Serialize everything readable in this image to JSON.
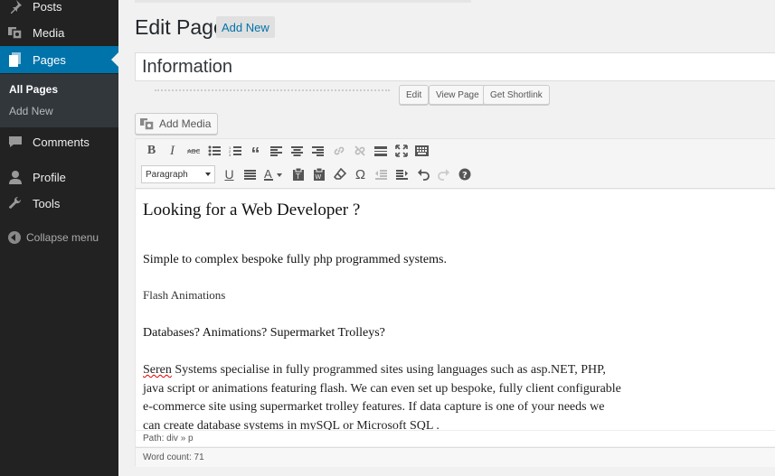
{
  "sidebar": {
    "menu": [
      {
        "label": "Posts",
        "icon": "pin-icon"
      },
      {
        "label": "Media",
        "icon": "media-icon"
      },
      {
        "label": "Pages",
        "icon": "pages-icon"
      },
      {
        "label": "Comments",
        "icon": "comment-icon"
      },
      {
        "label": "Profile",
        "icon": "user-icon"
      },
      {
        "label": "Tools",
        "icon": "wrench-icon"
      }
    ],
    "submenu": [
      {
        "label": "All Pages"
      },
      {
        "label": "Add New"
      }
    ],
    "collapse_label": "Collapse menu"
  },
  "header": {
    "title": "Edit Page",
    "add_new_label": "Add New"
  },
  "post_title": "Information",
  "permalink_buttons": {
    "edit": "Edit",
    "view_page": "View Page",
    "get_shortlink": "Get Shortlink"
  },
  "add_media_label": "Add Media",
  "editor": {
    "format_select": "Paragraph",
    "content": {
      "heading": "Looking for a Web Developer ?",
      "p1": "Simple to complex bespoke fully php programmed systems.",
      "p2": "Flash Animations",
      "p3": "Databases? Animations? Supermarket Trolleys?",
      "p4_first_word": "Seren",
      "p4_rest": " Systems specialise in fully programmed sites using languages such as asp.NET, PHP, java script or animations featuring flash. We can even set up bespoke, fully client configurable e-commerce site using supermarket trolley features. If data capture is one of your needs we can create database systems in mySQL or Microsoft SQL ."
    },
    "path": "Path: div » p",
    "word_count": "Word count: 71"
  },
  "colors": {
    "sidebar_bg": "#222222",
    "accent": "#0073aa",
    "link": "#0073aa"
  }
}
